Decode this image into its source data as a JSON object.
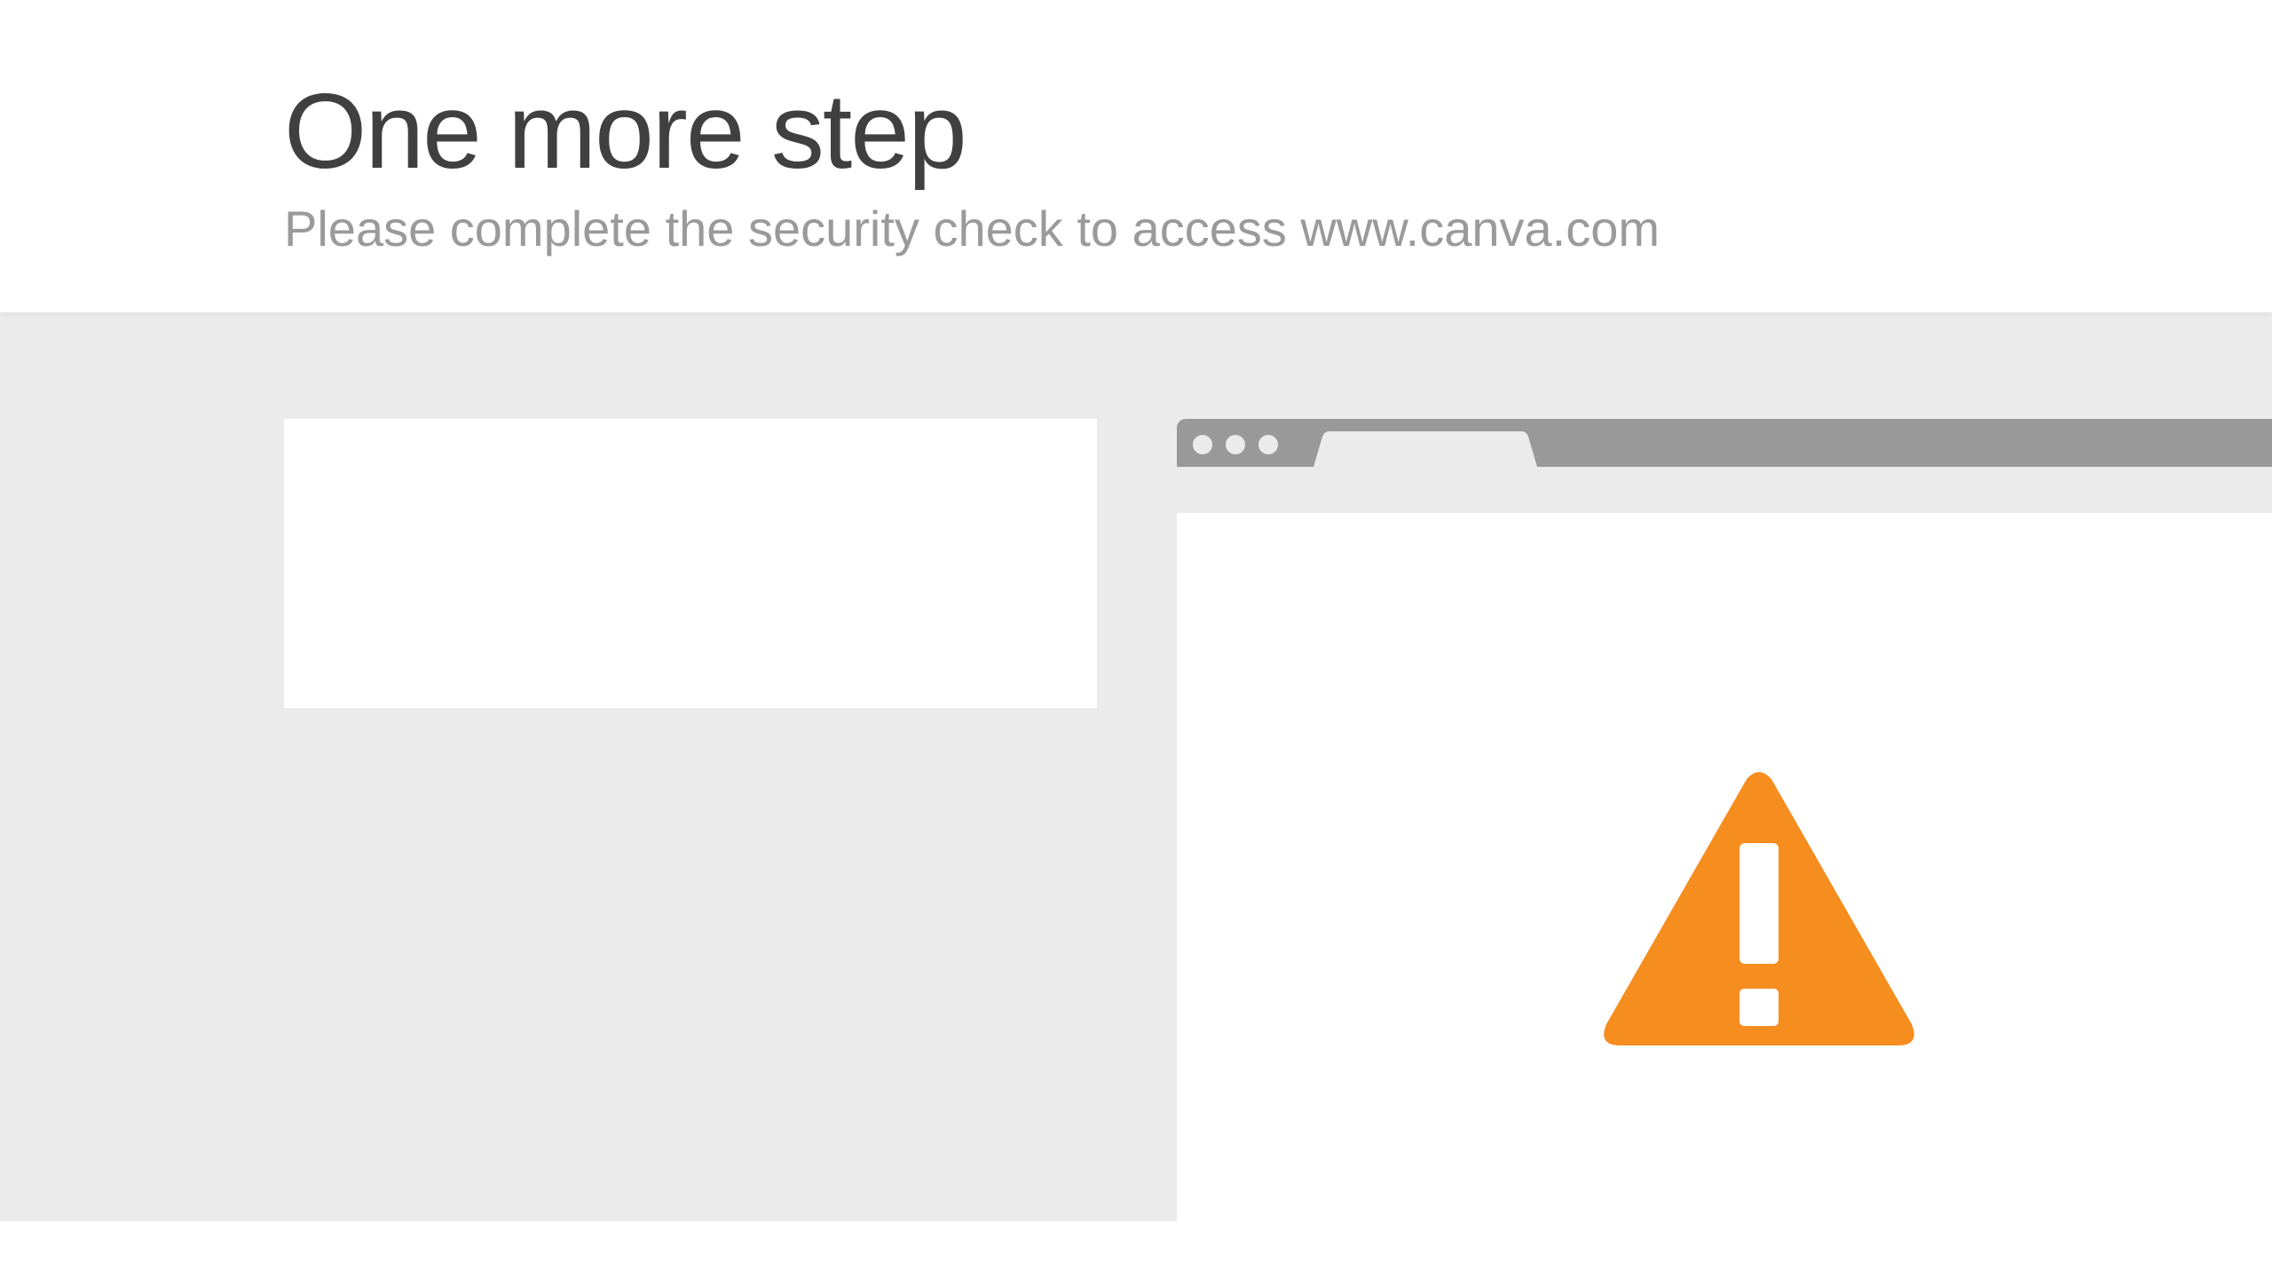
{
  "header": {
    "title": "One more step",
    "subtitle": "Please complete the security check to access www.canva.com"
  },
  "colors": {
    "title_text": "#404040",
    "subtitle_text": "#9a9a9a",
    "background_gray": "#ebebeb",
    "browser_bar": "#999999",
    "warning_orange": "#f68d1f"
  },
  "illustration": {
    "icon": "warning-icon"
  }
}
